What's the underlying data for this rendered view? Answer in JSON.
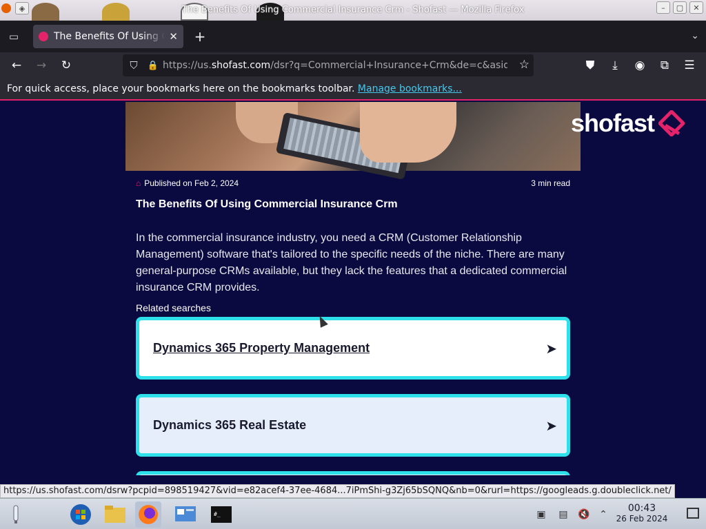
{
  "window": {
    "title": "The Benefits Of Using Commercial Insurance Crm - Shofast — Mozilla Firefox"
  },
  "tabs": [
    {
      "label": "The Benefits Of Using Commercial Insurance Crm - Shofast",
      "favicon": "shofast-favicon-icon"
    }
  ],
  "navbar": {
    "url_prefix": "https://us.",
    "url_domain": "shofast.com",
    "url_suffix": "/dsr?q=Commercial+Insurance+Crm&de=c&asid=",
    "icons": [
      "back-icon",
      "forward-icon",
      "reload-icon",
      "shield-icon",
      "lock-icon",
      "star-icon",
      "pocket-icon",
      "download-icon",
      "account-icon",
      "extensions-icon",
      "menu-icon"
    ]
  },
  "bookmarks_bar": {
    "message": "For quick access, place your bookmarks here on the bookmarks toolbar.",
    "link": "Manage bookmarks..."
  },
  "page": {
    "logo_text": "shofast",
    "published": "Published on Feb 2, 2024",
    "read_time": "3 min read",
    "title": "The Benefits Of Using Commercial Insurance Crm",
    "body": "In the commercial insurance industry, you need a CRM (Customer Relationship Management) software that's tailored to the specific needs of the niche. There are many general-purpose CRMs available, but they lack the features that a dedicated commercial insurance CRM provides.",
    "related_label": "Related searches",
    "related": [
      {
        "label": "Dynamics 365 Property Management"
      },
      {
        "label": "Dynamics 365 Real Estate"
      },
      {
        "label": ""
      }
    ],
    "colors": {
      "background": "#0a0a40",
      "accent": "#e4236a",
      "card_border": "#2ee0ea"
    }
  },
  "statusbar": {
    "text": "https://us.shofast.com/dsrw?pcpid=898519427&vid=e82acef4-37ee-4684...7iPmShi-g3Zj65bSQNQ&nb=0&rurl=https://googleads.g.doubleclick.net/"
  },
  "taskbar": {
    "time": "00:43",
    "date": "26 Feb 2024"
  }
}
